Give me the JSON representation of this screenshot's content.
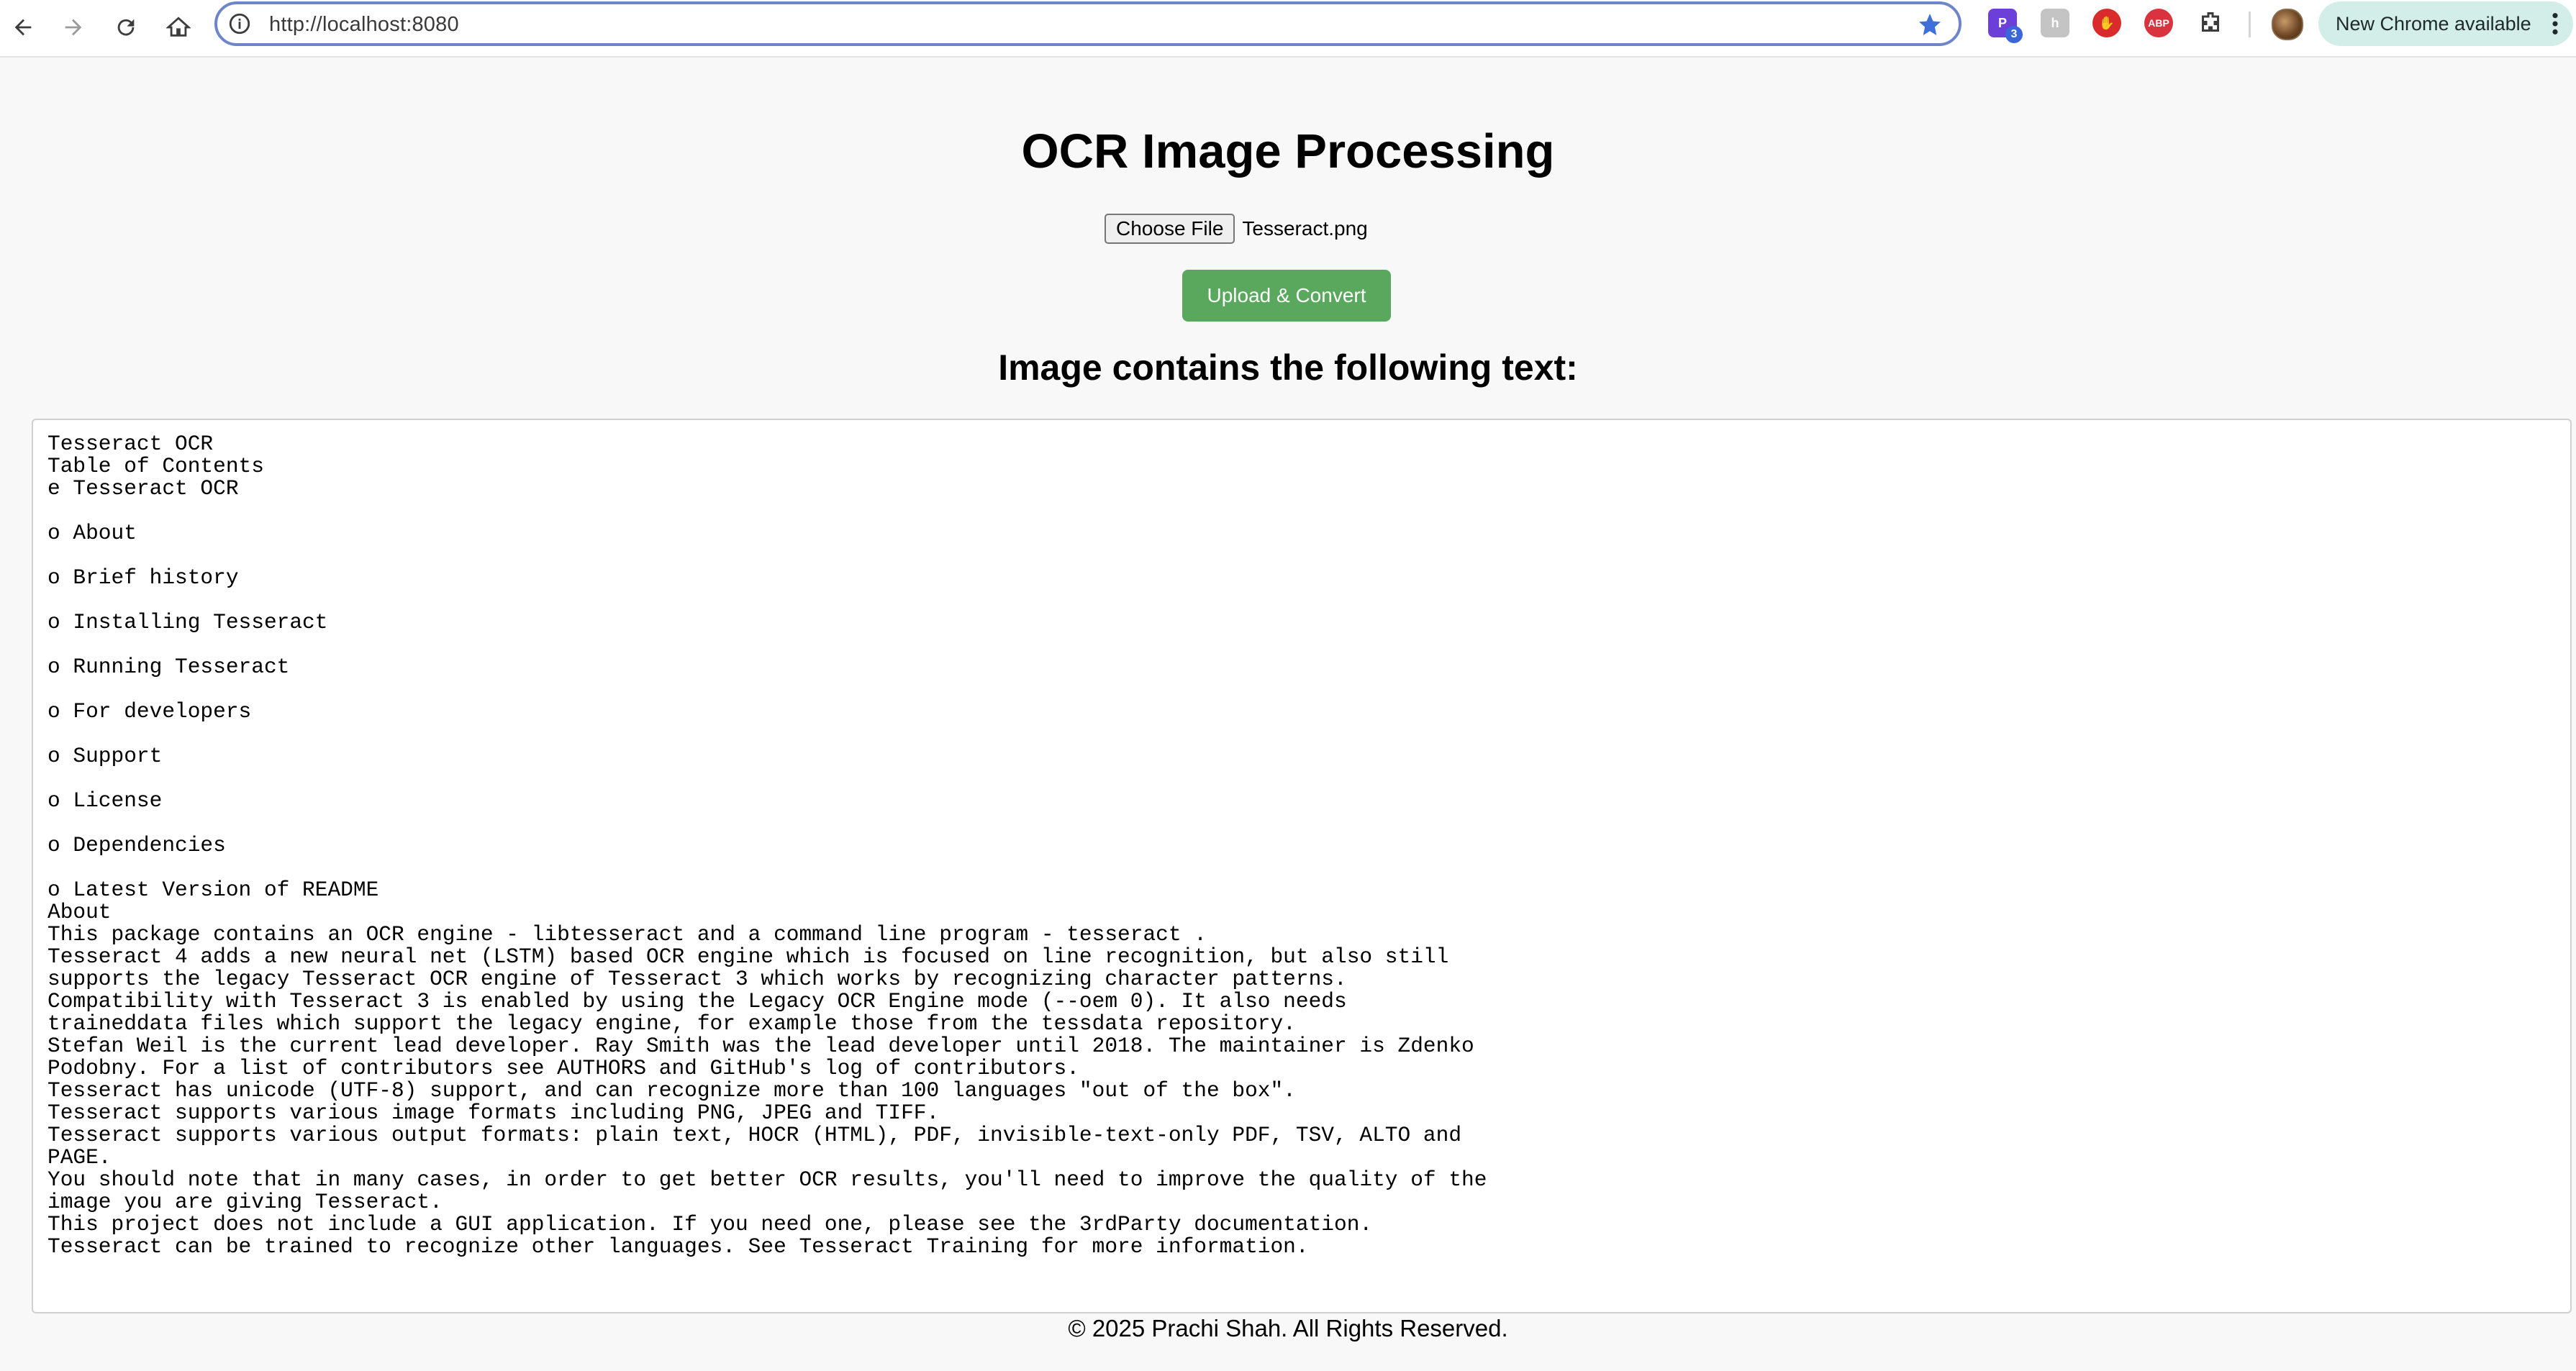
{
  "browser": {
    "url": "http://localhost:8080",
    "update_label": "New Chrome available",
    "extensions": [
      {
        "icon": "purple-extension-icon",
        "badge": "3",
        "color": "#6b3fd8"
      },
      {
        "icon": "grey-extension-icon",
        "color": "#b8b8b8"
      },
      {
        "icon": "red-hand-extension-icon",
        "color": "#d92b2b"
      },
      {
        "icon": "adblock-plus-icon",
        "label": "ABP",
        "color": "#d9333f"
      },
      {
        "icon": "puzzle-extensions-icon",
        "color": "#3c3c3c"
      }
    ]
  },
  "page": {
    "title": "OCR Image Processing",
    "file_input": {
      "button_label": "Choose File",
      "file_name": "Tesseract.png"
    },
    "upload_button": "Upload & Convert",
    "upload_button_color": "#5aa85d",
    "result_heading": "Image contains the following text:",
    "result_text": "Tesseract OCR\nTable of Contents\ne Tesseract OCR\n\no About\n\no Brief history\n\no Installing Tesseract\n\no Running Tesseract\n\no For developers\n\no Support\n\no License\n\no Dependencies\n\no Latest Version of README\nAbout\nThis package contains an OCR engine - libtesseract and a command line program - tesseract .\nTesseract 4 adds a new neural net (LSTM) based OCR engine which is focused on line recognition, but also still\nsupports the legacy Tesseract OCR engine of Tesseract 3 which works by recognizing character patterns.\nCompatibility with Tesseract 3 is enabled by using the Legacy OCR Engine mode (--oem 0). It also needs\ntraineddata files which support the legacy engine, for example those from the tessdata repository.\nStefan Weil is the current lead developer. Ray Smith was the lead developer until 2018. The maintainer is Zdenko\nPodobny. For a list of contributors see AUTHORS and GitHub's log of contributors.\nTesseract has unicode (UTF-8) support, and can recognize more than 100 languages \"out of the box\".\nTesseract supports various image formats including PNG, JPEG and TIFF.\nTesseract supports various output formats: plain text, HOCR (HTML), PDF, invisible-text-only PDF, TSV, ALTO and\nPAGE.\nYou should note that in many cases, in order to get better OCR results, you'll need to improve the quality of the\nimage you are giving Tesseract.\nThis project does not include a GUI application. If you need one, please see the 3rdParty documentation.\nTesseract can be trained to recognize other languages. See Tesseract Training for more information.",
    "footer": "© 2025 Prachi Shah. All Rights Reserved."
  }
}
